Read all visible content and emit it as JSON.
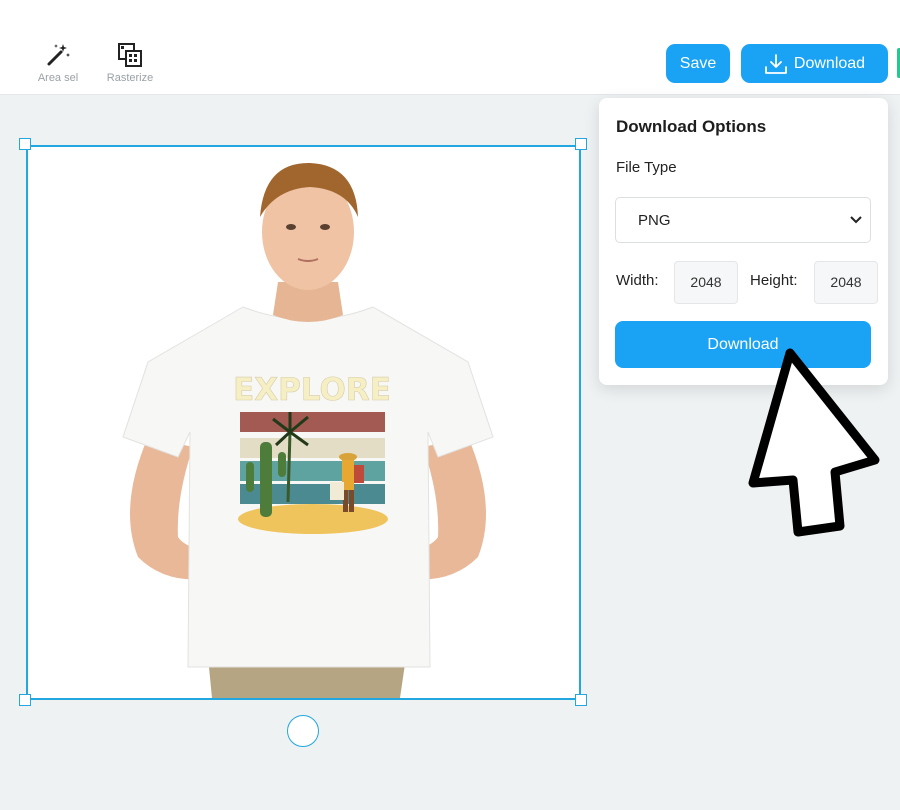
{
  "toolbar": {
    "tools": [
      {
        "label": "Area sel",
        "icon": "magic-wand-icon"
      },
      {
        "label": "Rasterize",
        "icon": "rasterize-icon"
      }
    ],
    "save_label": "Save",
    "download_label": "Download",
    "download_icon": "download-icon"
  },
  "canvas": {
    "shirt_print_text": "EXPLORE"
  },
  "download_panel": {
    "title": "Download Options",
    "file_type_label": "File Type",
    "file_type_value": "PNG",
    "width_label": "Width:",
    "width_value": "2048",
    "height_label": "Height:",
    "height_value": "2048",
    "download_button_label": "Download"
  },
  "colors": {
    "accent": "#1aa3f5",
    "selection": "#22a7e0",
    "canvas_bg": "#eef2f3"
  }
}
